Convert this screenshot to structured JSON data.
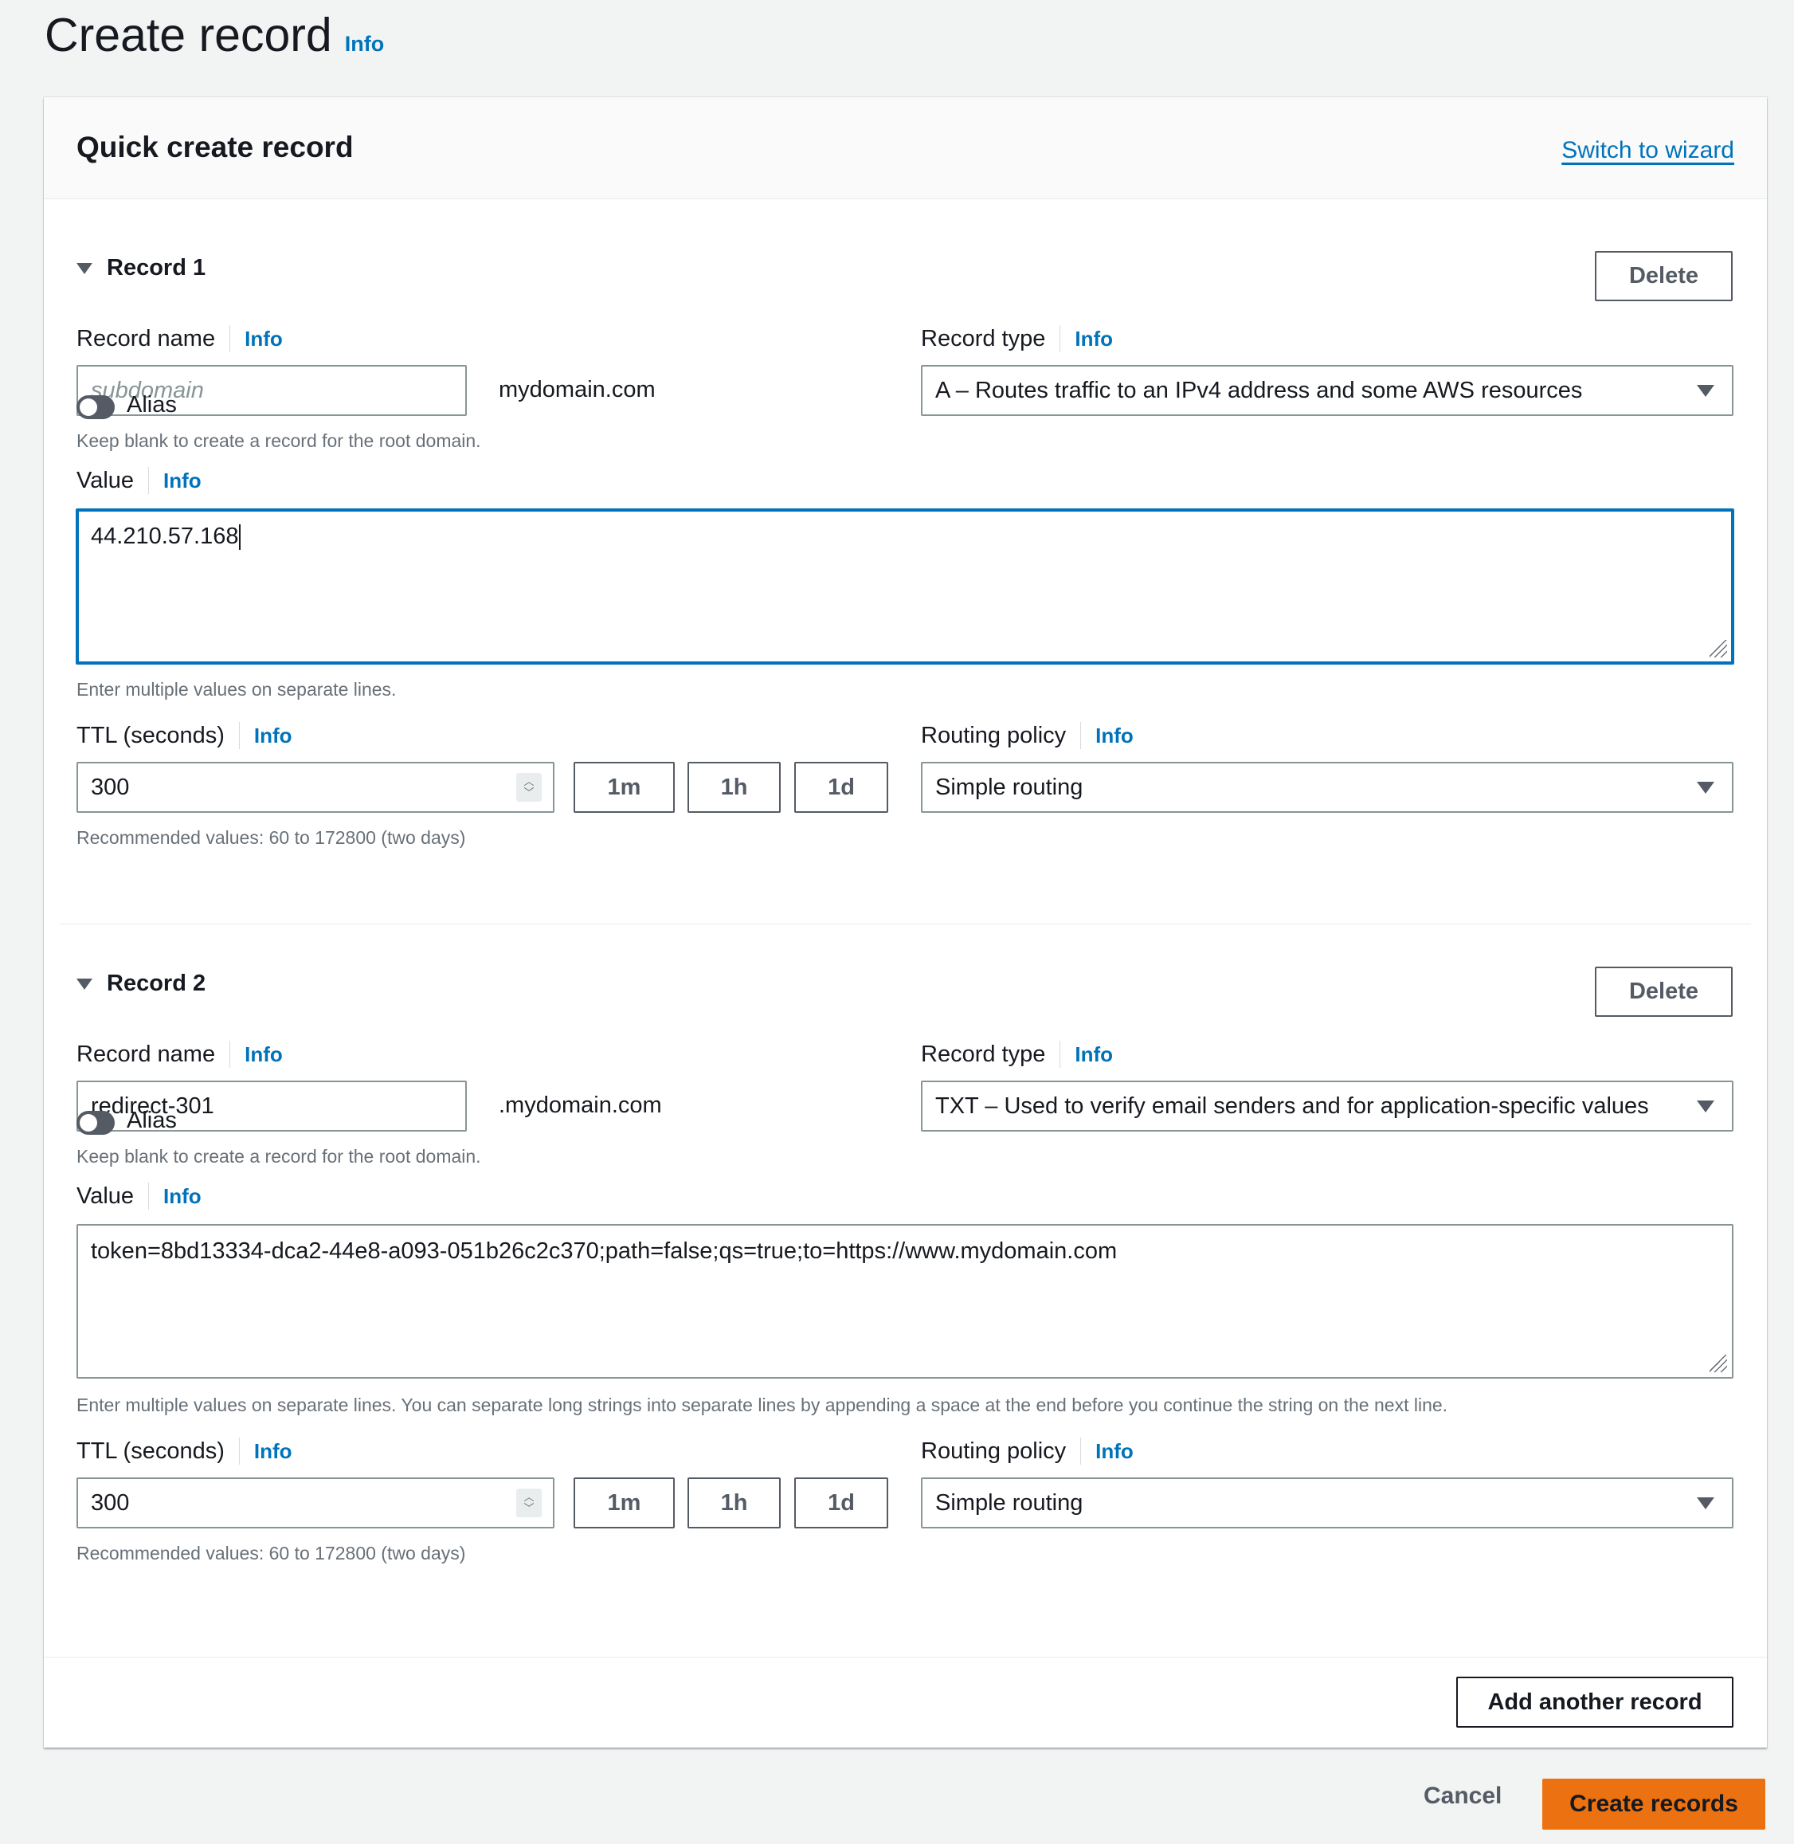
{
  "page": {
    "title": "Create record",
    "info": "Info"
  },
  "panel": {
    "title": "Quick create record",
    "switch_link": "Switch to wizard",
    "add_another": "Add another record"
  },
  "records": [
    {
      "heading": "Record 1",
      "delete_label": "Delete",
      "record_name_label": "Record name",
      "record_name_value": "",
      "record_name_placeholder": "subdomain",
      "domain_suffix": "mydomain.com",
      "record_name_hint": "Keep blank to create a record for the root domain.",
      "record_type_label": "Record type",
      "record_type_value": "A – Routes traffic to an IPv4 address and some AWS resources",
      "alias_label": "Alias",
      "value_label": "Value",
      "value_text": "44.210.57.168",
      "value_hint": "Enter multiple values on separate lines.",
      "ttl_label": "TTL (seconds)",
      "ttl_value": "300",
      "ttl_buttons": [
        "1m",
        "1h",
        "1d"
      ],
      "ttl_hint": "Recommended values: 60 to 172800 (two days)",
      "routing_label": "Routing policy",
      "routing_value": "Simple routing",
      "info": "Info"
    },
    {
      "heading": "Record 2",
      "delete_label": "Delete",
      "record_name_label": "Record name",
      "record_name_value": "redirect-301",
      "domain_suffix": ".mydomain.com",
      "record_name_hint": "Keep blank to create a record for the root domain.",
      "record_type_label": "Record type",
      "record_type_value": "TXT – Used to verify email senders and for application-specific values",
      "alias_label": "Alias",
      "value_label": "Value",
      "value_text": "token=8bd13334-dca2-44e8-a093-051b26c2c370;path=false;qs=true;to=https://www.mydomain.com",
      "value_hint": "Enter multiple values on separate lines. You can separate long strings into separate lines by appending a space at the end before you continue the string on the next line.",
      "ttl_label": "TTL (seconds)",
      "ttl_value": "300",
      "ttl_buttons": [
        "1m",
        "1h",
        "1d"
      ],
      "ttl_hint": "Recommended values: 60 to 172800 (two days)",
      "routing_label": "Routing policy",
      "routing_value": "Simple routing",
      "info": "Info"
    }
  ],
  "footer": {
    "cancel": "Cancel",
    "create": "Create records"
  },
  "colors": {
    "accent": "#0073bb",
    "primary_button": "#ec7211",
    "background": "#f2f3f3"
  },
  "icons": {
    "expand": "caret-down-icon",
    "select": "triangle-down-icon",
    "spinner": "chevron-up-down-icon",
    "resize": "resize-handle-icon"
  }
}
